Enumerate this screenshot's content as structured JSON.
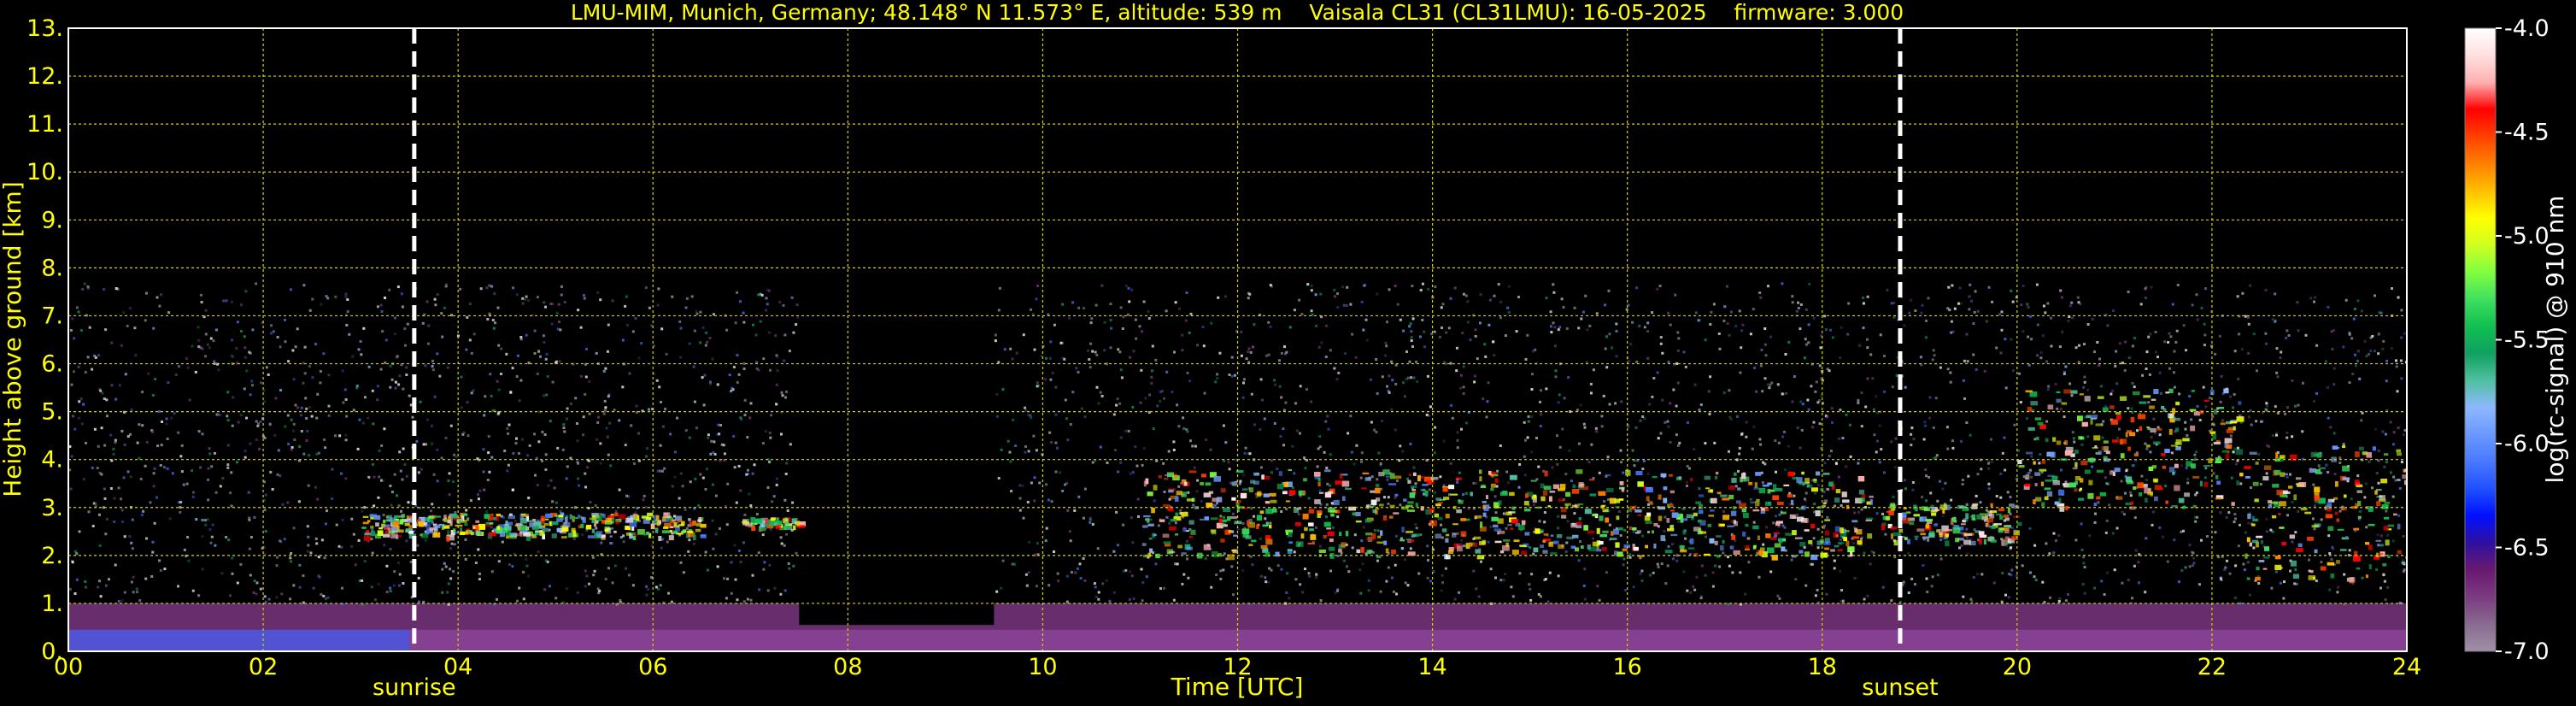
{
  "chart_data": {
    "type": "heatmap",
    "title": "LMU-MIM, Munich, Germany; 48.148° N 11.573° E, altitude: 539 m    Vaisala CL31 (CL31LMU): 16-05-2025    firmware: 3.000",
    "xlabel": "Time [UTC]",
    "ylabel": "Height above ground [km]",
    "xlim": [
      0,
      24
    ],
    "ylim": [
      0,
      13
    ],
    "x_ticks": [
      "00",
      "02",
      "04",
      "06",
      "08",
      "10",
      "12",
      "14",
      "16",
      "18",
      "20",
      "22",
      "24"
    ],
    "y_ticks": [
      "0.",
      "1.",
      "2.",
      "3.",
      "4.",
      "5.",
      "6.",
      "7.",
      "8.",
      "9.",
      "10.",
      "11.",
      "12.",
      "13."
    ],
    "grid": true,
    "events": [
      {
        "label": "sunrise",
        "time": 3.55
      },
      {
        "label": "sunset",
        "time": 18.8
      }
    ],
    "colorbar": {
      "label": "log(rc-signal) @ 910 nm",
      "range": [
        -7.0,
        -4.0
      ],
      "ticks": [
        "-4.0",
        "-4.5",
        "-5.0",
        "-5.5",
        "-6.0",
        "-6.5",
        "-7.0"
      ],
      "colors": [
        "#a090a8",
        "#8a6a90",
        "#7a3c80",
        "#6a1870",
        "#3010a0",
        "#0010ff",
        "#2050ff",
        "#4878ff",
        "#6a98ff",
        "#8cb8ff",
        "#50c0a0",
        "#10a060",
        "#10c050",
        "#40e060",
        "#80ff40",
        "#d0ff20",
        "#ffff00",
        "#ffc000",
        "#ff8000",
        "#ff4000",
        "#ff0000",
        "#ffb0b0",
        "#ffe0e0",
        "#ffffff"
      ]
    },
    "features": [
      {
        "kind": "aerosol_layer",
        "x": [
          0,
          24
        ],
        "y_top": 1.0,
        "color": "#8a3c90"
      },
      {
        "kind": "noise_region",
        "x": [
          0,
          24
        ],
        "y_top": 7.7
      },
      {
        "kind": "data_gap",
        "x": [
          7.5,
          9.5
        ]
      },
      {
        "kind": "cloud_layer",
        "x": [
          3.0,
          6.5
        ],
        "y": [
          2.4,
          2.9
        ]
      },
      {
        "kind": "cloud_layer",
        "x": [
          6.9,
          7.5
        ],
        "y": [
          2.6,
          2.8
        ]
      },
      {
        "kind": "cloud_layer",
        "x": [
          11.0,
          18.5
        ],
        "y": [
          2.0,
          3.8
        ]
      },
      {
        "kind": "cloud_layer",
        "x": [
          18.6,
          20.0
        ],
        "y": [
          2.3,
          3.1
        ]
      },
      {
        "kind": "cloud_layer",
        "x": [
          20.0,
          22.3
        ],
        "y": [
          3.0,
          5.5
        ]
      },
      {
        "kind": "cloud_layer",
        "x": [
          22.3,
          24.0
        ],
        "y": [
          1.5,
          4.3
        ]
      }
    ]
  }
}
